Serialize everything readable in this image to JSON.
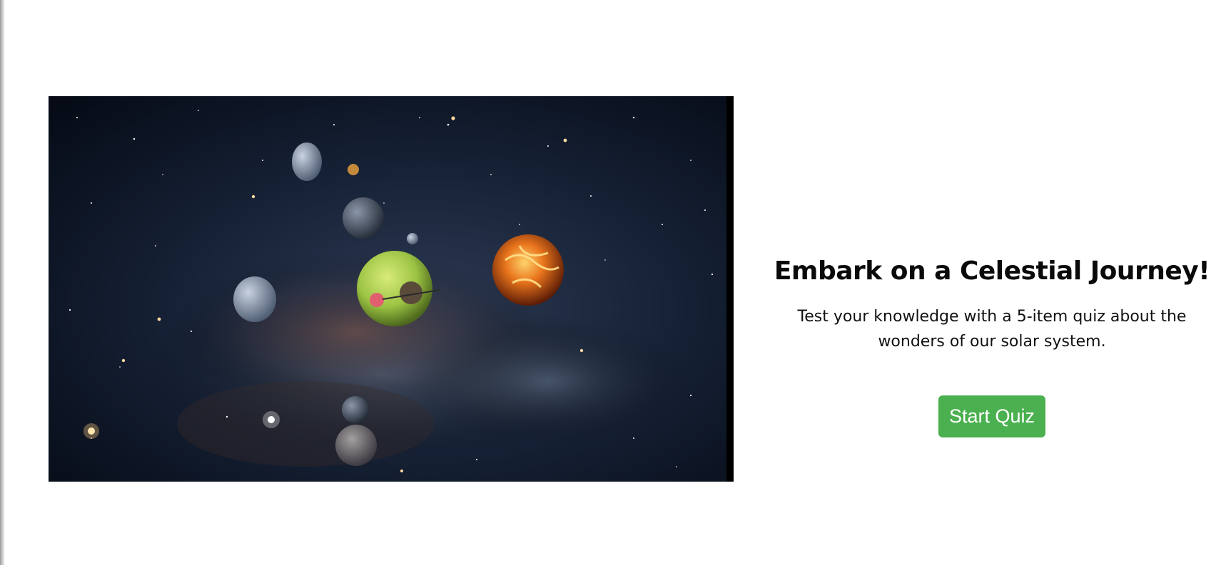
{
  "hero": {
    "image_icon": "solar-system-video",
    "headline": "Embark on a Celestial Journey!",
    "description": "Test your knowledge with a 5-item quiz about the wonders of our solar system.",
    "start_button_label": "Start Quiz",
    "accent_color": "#4bb04f"
  }
}
